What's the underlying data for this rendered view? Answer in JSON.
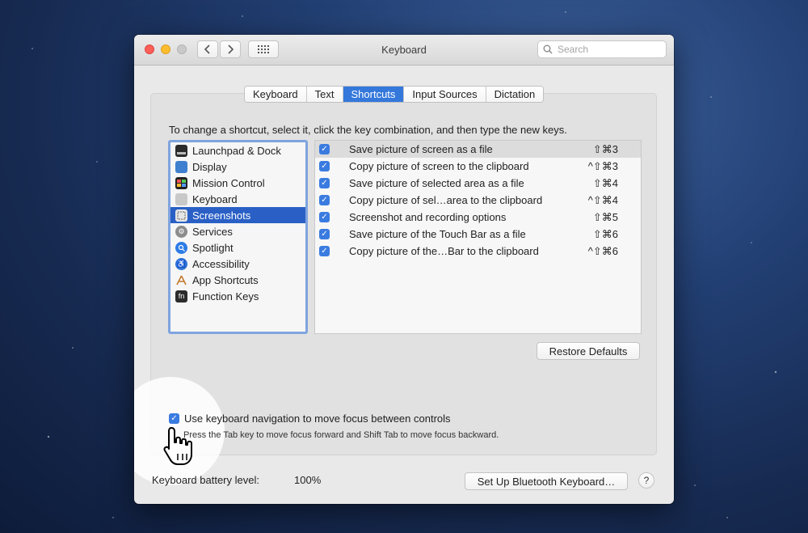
{
  "window": {
    "title": "Keyboard"
  },
  "toolbar": {
    "back_icon": "chevron-left-icon",
    "forward_icon": "chevron-right-icon",
    "grid_icon": "grid-icon"
  },
  "search": {
    "placeholder": "Search",
    "icon": "magnifier-icon"
  },
  "tabs": [
    {
      "label": "Keyboard",
      "active": false
    },
    {
      "label": "Text",
      "active": false
    },
    {
      "label": "Shortcuts",
      "active": true
    },
    {
      "label": "Input Sources",
      "active": false
    },
    {
      "label": "Dictation",
      "active": false
    }
  ],
  "instruction": "To change a shortcut, select it, click the key combination, and then type the new keys.",
  "sidebar": {
    "items": [
      {
        "label": "Launchpad & Dock",
        "icon": "launchpad-dock-icon",
        "selected": false
      },
      {
        "label": "Display",
        "icon": "display-icon",
        "selected": false
      },
      {
        "label": "Mission Control",
        "icon": "mission-control-icon",
        "selected": false
      },
      {
        "label": "Keyboard",
        "icon": "keyboard-icon",
        "selected": false
      },
      {
        "label": "Screenshots",
        "icon": "screenshots-icon",
        "selected": true
      },
      {
        "label": "Services",
        "icon": "gear-icon",
        "selected": false
      },
      {
        "label": "Spotlight",
        "icon": "spotlight-icon",
        "selected": false
      },
      {
        "label": "Accessibility",
        "icon": "accessibility-icon",
        "selected": false
      },
      {
        "label": "App Shortcuts",
        "icon": "app-shortcuts-icon",
        "selected": false
      },
      {
        "label": "Function Keys",
        "icon": "fn-icon",
        "selected": false
      }
    ]
  },
  "shortcuts": [
    {
      "checked": true,
      "label": "Save picture of screen as a file",
      "keys": "⇧⌘3"
    },
    {
      "checked": true,
      "label": "Copy picture of screen to the clipboard",
      "keys": "^⇧⌘3"
    },
    {
      "checked": true,
      "label": "Save picture of selected area as a file",
      "keys": "⇧⌘4"
    },
    {
      "checked": true,
      "label": "Copy picture of sel…area to the clipboard",
      "keys": "^⇧⌘4"
    },
    {
      "checked": true,
      "label": "Screenshot and recording options",
      "keys": "⇧⌘5"
    },
    {
      "checked": true,
      "label": "Save picture of the Touch Bar as a file",
      "keys": "⇧⌘6"
    },
    {
      "checked": true,
      "label": "Copy picture of the…Bar to the clipboard",
      "keys": "^⇧⌘6"
    }
  ],
  "restore_defaults_label": "Restore Defaults",
  "keyboard_navigation": {
    "checked": true,
    "label": "Use keyboard navigation to move focus between controls",
    "note": "Press the Tab key to move focus forward and Shift Tab to move focus backward."
  },
  "battery": {
    "label": "Keyboard battery level:",
    "value": "100%"
  },
  "bluetooth_button_label": "Set Up Bluetooth Keyboard…",
  "help_label": "?",
  "colors": {
    "accent": "#3478db",
    "selection": "#2a60c5",
    "checkbox": "#3a7be0"
  }
}
